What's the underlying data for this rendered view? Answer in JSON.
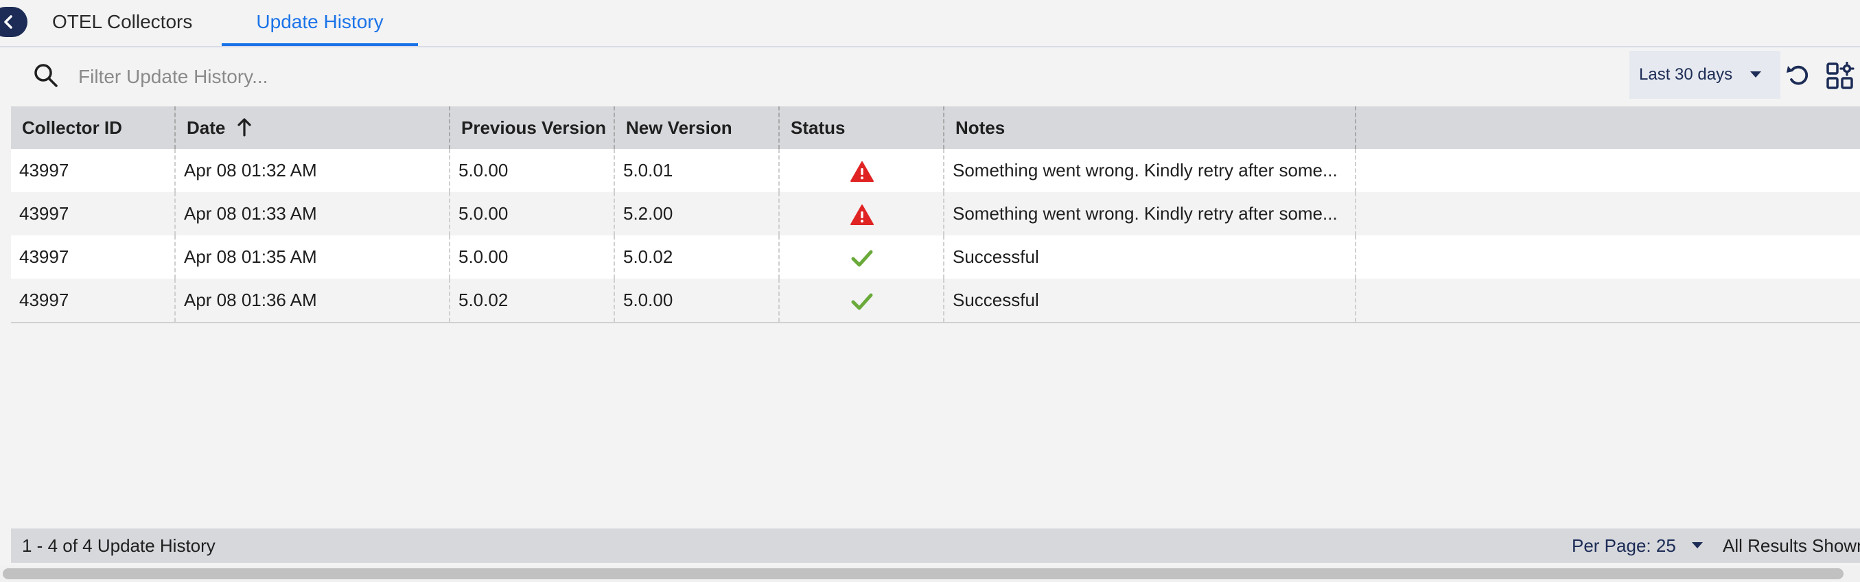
{
  "tabs": {
    "otel_collectors": "OTEL Collectors",
    "update_history": "Update History"
  },
  "toolbar": {
    "search_placeholder": "Filter Update History...",
    "search_value": "",
    "date_range": "Last 30 days"
  },
  "table": {
    "columns": [
      "Collector ID",
      "Date",
      "Previous Version",
      "New Version",
      "Status",
      "Notes"
    ],
    "sort": {
      "column": "Date",
      "direction": "ascending"
    },
    "rows": [
      {
        "collector_id": "43997",
        "date": "Apr 08 01:32 AM",
        "previous_version": "5.0.00",
        "new_version": "5.0.01",
        "status": "error",
        "notes": "Something went wrong. Kindly retry after some..."
      },
      {
        "collector_id": "43997",
        "date": "Apr 08 01:33 AM",
        "previous_version": "5.0.00",
        "new_version": "5.2.00",
        "status": "error",
        "notes": "Something went wrong. Kindly retry after some..."
      },
      {
        "collector_id": "43997",
        "date": "Apr 08 01:35 AM",
        "previous_version": "5.0.00",
        "new_version": "5.0.02",
        "status": "success",
        "notes": "Successful"
      },
      {
        "collector_id": "43997",
        "date": "Apr 08 01:36 AM",
        "previous_version": "5.0.02",
        "new_version": "5.0.00",
        "status": "success",
        "notes": "Successful"
      }
    ]
  },
  "footer": {
    "count": "1 - 4 of 4 Update History",
    "per_page": "Per Page: 25",
    "all_results": "All Results Shown"
  },
  "colors": {
    "accent": "#1a73e8",
    "nav": "#1c2c56",
    "error": "#e02424",
    "success": "#6aaa3a"
  }
}
